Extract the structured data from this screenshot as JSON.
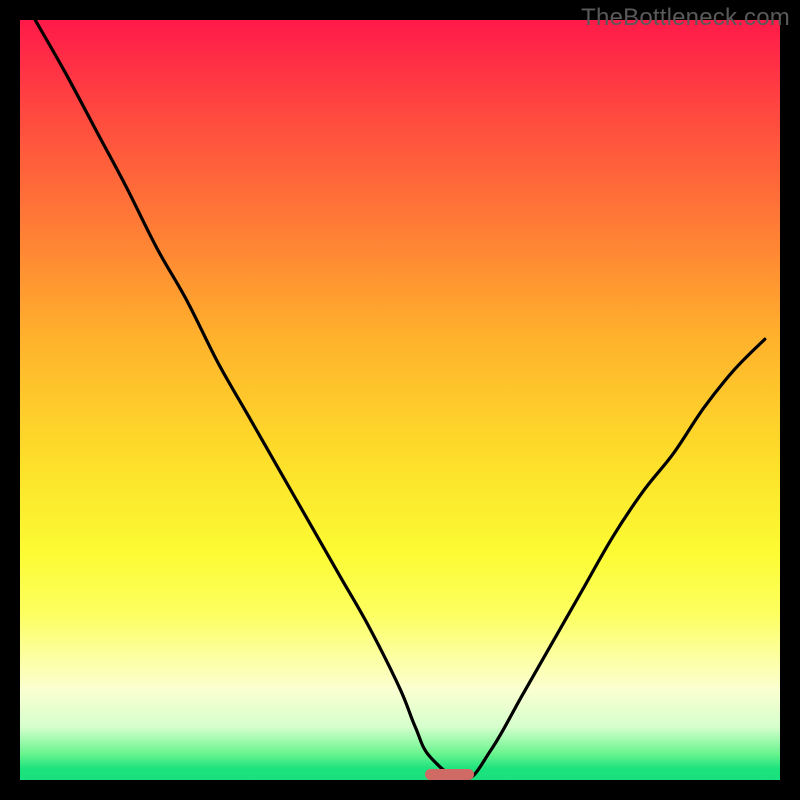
{
  "watermark": {
    "text": "TheBottleneck.com"
  },
  "colors": {
    "frame": "#000000",
    "gradient_top": "#ff1a49",
    "gradient_mid": "#fddf2a",
    "gradient_bottom": "#19e07e",
    "curve": "#000000",
    "marker": "#cf6b64",
    "watermark": "#5a5a5a"
  },
  "chart_data": {
    "type": "line",
    "title": "",
    "xlabel": "",
    "ylabel": "",
    "xlim": [
      0,
      100
    ],
    "ylim": [
      0,
      100
    ],
    "grid": false,
    "legend": false,
    "series": [
      {
        "name": "bottleneck-curve",
        "x": [
          2,
          6,
          10,
          14,
          18,
          22,
          26,
          30,
          34,
          38,
          42,
          46,
          50,
          52,
          54,
          58.5,
          62,
          66,
          70,
          74,
          78,
          82,
          86,
          90,
          94,
          98
        ],
        "y": [
          100,
          93,
          85.5,
          78,
          70,
          63,
          55,
          48,
          41,
          34,
          27,
          20,
          12,
          7,
          3,
          0,
          4,
          11,
          18,
          25,
          32,
          38,
          43,
          49,
          54,
          58
        ]
      }
    ],
    "annotations": [
      {
        "type": "pill-marker",
        "x_center": 56.5,
        "y": 0,
        "width_pct": 6.5,
        "color": "#cf6b64"
      }
    ],
    "notes": "Background is a smooth red→yellow→green vertical gradient; y represents bottleneck severity (0 = ideal at green bottom, 100 = worst at red top). Values are estimated from pixel positions — no axis ticks are shown."
  }
}
